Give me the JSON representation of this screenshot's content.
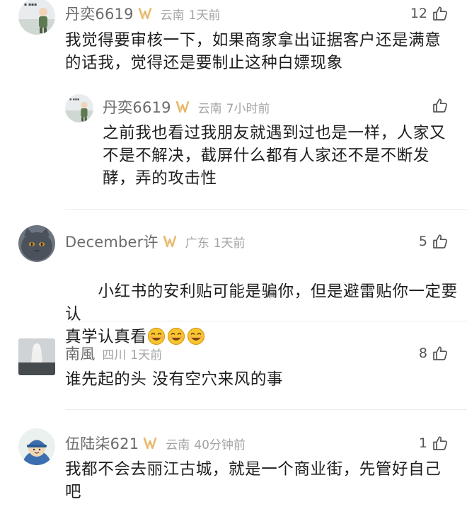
{
  "comments": [
    {
      "username": "丹奕6619",
      "location": "云南",
      "time": "1天前",
      "likes": "12",
      "content": "我觉得要审核一下，如果商家拿出证据客户还是满意\n的话我，觉得还是要制止这种白嫖现象",
      "replies": [
        {
          "username": "丹奕6619",
          "location": "云南",
          "time": "7小时前",
          "likes": "",
          "content": "之前我也看过我朋友就遇到过也是一样，人家又\n不是不解决，截屏什么都有人家还不是不断发\n酵，弄的攻击性"
        }
      ]
    },
    {
      "username": "December许",
      "location": "广东",
      "time": "1天前",
      "likes": "5",
      "content": "小红书的安利贴可能是骗你，但是避雷贴你一定要认\n真学认真看",
      "emoji_count": 3
    },
    {
      "username": "南風",
      "location": "四川",
      "time": "1天前",
      "likes": "8",
      "content": "谁先起的头 没有空穴来风的事"
    },
    {
      "username": "伍陆柒621",
      "location": "云南",
      "time": "40分钟前",
      "likes": "1",
      "content": "我都不会去丽江古城，就是一个商业街，先管好自己\n吧"
    }
  ],
  "icons": {
    "like": "thumbs-up-outline-icon",
    "vip": "vip-w-badge-icon",
    "emoji": "smiling-face-emoji-icon"
  },
  "colors": {
    "vip_badge": "#e6b86a",
    "username": "#6b6b6b",
    "meta": "#a3a3a3",
    "text": "#1e1e1e"
  }
}
